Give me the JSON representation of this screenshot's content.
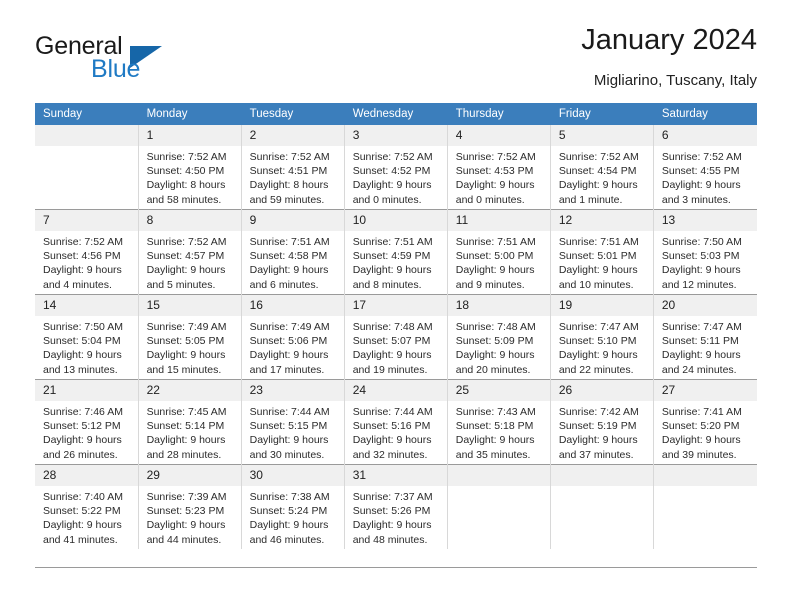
{
  "brand": {
    "name_part1": "General",
    "name_part2": "Blue"
  },
  "header": {
    "title": "January 2024",
    "subtitle": "Migliarino, Tuscany, Italy"
  },
  "colors": {
    "header_blue": "#3b7ebc",
    "brand_blue": "#1f7ac4",
    "daynum_bg": "#f0f0f0"
  },
  "weekdays": [
    "Sunday",
    "Monday",
    "Tuesday",
    "Wednesday",
    "Thursday",
    "Friday",
    "Saturday"
  ],
  "weeks": [
    [
      {
        "day": "",
        "sunrise": "",
        "sunset": "",
        "daylight1": "",
        "daylight2": ""
      },
      {
        "day": "1",
        "sunrise": "Sunrise: 7:52 AM",
        "sunset": "Sunset: 4:50 PM",
        "daylight1": "Daylight: 8 hours",
        "daylight2": "and 58 minutes."
      },
      {
        "day": "2",
        "sunrise": "Sunrise: 7:52 AM",
        "sunset": "Sunset: 4:51 PM",
        "daylight1": "Daylight: 8 hours",
        "daylight2": "and 59 minutes."
      },
      {
        "day": "3",
        "sunrise": "Sunrise: 7:52 AM",
        "sunset": "Sunset: 4:52 PM",
        "daylight1": "Daylight: 9 hours",
        "daylight2": "and 0 minutes."
      },
      {
        "day": "4",
        "sunrise": "Sunrise: 7:52 AM",
        "sunset": "Sunset: 4:53 PM",
        "daylight1": "Daylight: 9 hours",
        "daylight2": "and 0 minutes."
      },
      {
        "day": "5",
        "sunrise": "Sunrise: 7:52 AM",
        "sunset": "Sunset: 4:54 PM",
        "daylight1": "Daylight: 9 hours",
        "daylight2": "and 1 minute."
      },
      {
        "day": "6",
        "sunrise": "Sunrise: 7:52 AM",
        "sunset": "Sunset: 4:55 PM",
        "daylight1": "Daylight: 9 hours",
        "daylight2": "and 3 minutes."
      }
    ],
    [
      {
        "day": "7",
        "sunrise": "Sunrise: 7:52 AM",
        "sunset": "Sunset: 4:56 PM",
        "daylight1": "Daylight: 9 hours",
        "daylight2": "and 4 minutes."
      },
      {
        "day": "8",
        "sunrise": "Sunrise: 7:52 AM",
        "sunset": "Sunset: 4:57 PM",
        "daylight1": "Daylight: 9 hours",
        "daylight2": "and 5 minutes."
      },
      {
        "day": "9",
        "sunrise": "Sunrise: 7:51 AM",
        "sunset": "Sunset: 4:58 PM",
        "daylight1": "Daylight: 9 hours",
        "daylight2": "and 6 minutes."
      },
      {
        "day": "10",
        "sunrise": "Sunrise: 7:51 AM",
        "sunset": "Sunset: 4:59 PM",
        "daylight1": "Daylight: 9 hours",
        "daylight2": "and 8 minutes."
      },
      {
        "day": "11",
        "sunrise": "Sunrise: 7:51 AM",
        "sunset": "Sunset: 5:00 PM",
        "daylight1": "Daylight: 9 hours",
        "daylight2": "and 9 minutes."
      },
      {
        "day": "12",
        "sunrise": "Sunrise: 7:51 AM",
        "sunset": "Sunset: 5:01 PM",
        "daylight1": "Daylight: 9 hours",
        "daylight2": "and 10 minutes."
      },
      {
        "day": "13",
        "sunrise": "Sunrise: 7:50 AM",
        "sunset": "Sunset: 5:03 PM",
        "daylight1": "Daylight: 9 hours",
        "daylight2": "and 12 minutes."
      }
    ],
    [
      {
        "day": "14",
        "sunrise": "Sunrise: 7:50 AM",
        "sunset": "Sunset: 5:04 PM",
        "daylight1": "Daylight: 9 hours",
        "daylight2": "and 13 minutes."
      },
      {
        "day": "15",
        "sunrise": "Sunrise: 7:49 AM",
        "sunset": "Sunset: 5:05 PM",
        "daylight1": "Daylight: 9 hours",
        "daylight2": "and 15 minutes."
      },
      {
        "day": "16",
        "sunrise": "Sunrise: 7:49 AM",
        "sunset": "Sunset: 5:06 PM",
        "daylight1": "Daylight: 9 hours",
        "daylight2": "and 17 minutes."
      },
      {
        "day": "17",
        "sunrise": "Sunrise: 7:48 AM",
        "sunset": "Sunset: 5:07 PM",
        "daylight1": "Daylight: 9 hours",
        "daylight2": "and 19 minutes."
      },
      {
        "day": "18",
        "sunrise": "Sunrise: 7:48 AM",
        "sunset": "Sunset: 5:09 PM",
        "daylight1": "Daylight: 9 hours",
        "daylight2": "and 20 minutes."
      },
      {
        "day": "19",
        "sunrise": "Sunrise: 7:47 AM",
        "sunset": "Sunset: 5:10 PM",
        "daylight1": "Daylight: 9 hours",
        "daylight2": "and 22 minutes."
      },
      {
        "day": "20",
        "sunrise": "Sunrise: 7:47 AM",
        "sunset": "Sunset: 5:11 PM",
        "daylight1": "Daylight: 9 hours",
        "daylight2": "and 24 minutes."
      }
    ],
    [
      {
        "day": "21",
        "sunrise": "Sunrise: 7:46 AM",
        "sunset": "Sunset: 5:12 PM",
        "daylight1": "Daylight: 9 hours",
        "daylight2": "and 26 minutes."
      },
      {
        "day": "22",
        "sunrise": "Sunrise: 7:45 AM",
        "sunset": "Sunset: 5:14 PM",
        "daylight1": "Daylight: 9 hours",
        "daylight2": "and 28 minutes."
      },
      {
        "day": "23",
        "sunrise": "Sunrise: 7:44 AM",
        "sunset": "Sunset: 5:15 PM",
        "daylight1": "Daylight: 9 hours",
        "daylight2": "and 30 minutes."
      },
      {
        "day": "24",
        "sunrise": "Sunrise: 7:44 AM",
        "sunset": "Sunset: 5:16 PM",
        "daylight1": "Daylight: 9 hours",
        "daylight2": "and 32 minutes."
      },
      {
        "day": "25",
        "sunrise": "Sunrise: 7:43 AM",
        "sunset": "Sunset: 5:18 PM",
        "daylight1": "Daylight: 9 hours",
        "daylight2": "and 35 minutes."
      },
      {
        "day": "26",
        "sunrise": "Sunrise: 7:42 AM",
        "sunset": "Sunset: 5:19 PM",
        "daylight1": "Daylight: 9 hours",
        "daylight2": "and 37 minutes."
      },
      {
        "day": "27",
        "sunrise": "Sunrise: 7:41 AM",
        "sunset": "Sunset: 5:20 PM",
        "daylight1": "Daylight: 9 hours",
        "daylight2": "and 39 minutes."
      }
    ],
    [
      {
        "day": "28",
        "sunrise": "Sunrise: 7:40 AM",
        "sunset": "Sunset: 5:22 PM",
        "daylight1": "Daylight: 9 hours",
        "daylight2": "and 41 minutes."
      },
      {
        "day": "29",
        "sunrise": "Sunrise: 7:39 AM",
        "sunset": "Sunset: 5:23 PM",
        "daylight1": "Daylight: 9 hours",
        "daylight2": "and 44 minutes."
      },
      {
        "day": "30",
        "sunrise": "Sunrise: 7:38 AM",
        "sunset": "Sunset: 5:24 PM",
        "daylight1": "Daylight: 9 hours",
        "daylight2": "and 46 minutes."
      },
      {
        "day": "31",
        "sunrise": "Sunrise: 7:37 AM",
        "sunset": "Sunset: 5:26 PM",
        "daylight1": "Daylight: 9 hours",
        "daylight2": "and 48 minutes."
      },
      {
        "day": "",
        "sunrise": "",
        "sunset": "",
        "daylight1": "",
        "daylight2": ""
      },
      {
        "day": "",
        "sunrise": "",
        "sunset": "",
        "daylight1": "",
        "daylight2": ""
      },
      {
        "day": "",
        "sunrise": "",
        "sunset": "",
        "daylight1": "",
        "daylight2": ""
      }
    ]
  ]
}
